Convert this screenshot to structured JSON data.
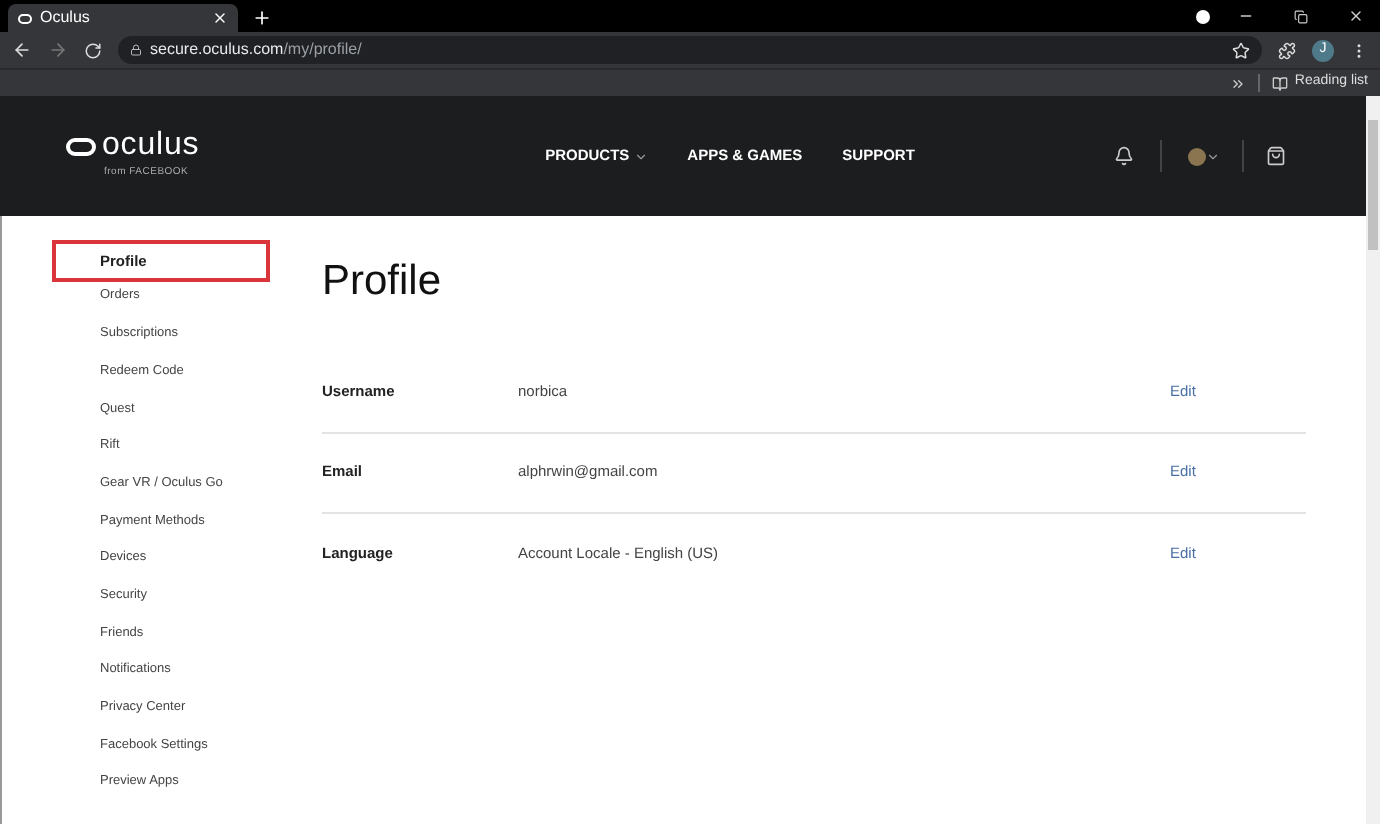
{
  "browser": {
    "tab_title": "Oculus",
    "url_host": "secure.oculus.com",
    "url_path": "/my/profile/",
    "profile_initial": "J",
    "reading_list": "Reading list"
  },
  "header": {
    "logo": "oculus",
    "logo_sub": "from FACEBOOK",
    "nav": [
      "PRODUCTS",
      "APPS & GAMES",
      "SUPPORT"
    ]
  },
  "sidebar": {
    "items": [
      {
        "label": "Profile",
        "selected": true
      },
      {
        "label": "Orders",
        "selected": false
      },
      {
        "label": "Subscriptions",
        "selected": false
      },
      {
        "label": "Redeem Code",
        "selected": false
      },
      {
        "label": "Quest",
        "selected": false
      },
      {
        "label": "Rift",
        "selected": false
      },
      {
        "label": "Gear VR / Oculus Go",
        "selected": false
      },
      {
        "label": "Payment Methods",
        "selected": false
      },
      {
        "label": "Devices",
        "selected": false
      },
      {
        "label": "Security",
        "selected": false
      },
      {
        "label": "Friends",
        "selected": false
      },
      {
        "label": "Notifications",
        "selected": false
      },
      {
        "label": "Privacy Center",
        "selected": false
      },
      {
        "label": "Facebook Settings",
        "selected": false
      },
      {
        "label": "Preview Apps",
        "selected": false
      }
    ]
  },
  "profile": {
    "title": "Profile",
    "rows": [
      {
        "label": "Username",
        "value": "norbica",
        "action": "Edit"
      },
      {
        "label": "Email",
        "value": "alphrwin@gmail.com",
        "action": "Edit"
      },
      {
        "label": "Language",
        "value": "Account Locale - English (US)",
        "action": "Edit"
      }
    ]
  }
}
